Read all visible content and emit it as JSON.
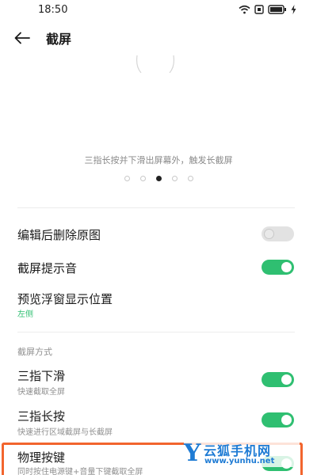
{
  "status_bar": {
    "time": "18:50",
    "icons": [
      "wifi-icon",
      "sim-icon",
      "battery-icon",
      "charging-icon"
    ]
  },
  "header": {
    "back_icon": "arrow-left-icon",
    "title": "截屏"
  },
  "preview": {
    "caption": "三指长按并下滑出屏幕外，触发长截屏",
    "pager": {
      "total": 5,
      "active_index": 2
    }
  },
  "settings": {
    "delete_original": {
      "label": "编辑后删除原图",
      "enabled": false
    },
    "screenshot_sound": {
      "label": "截屏提示音",
      "enabled": true
    },
    "preview_position": {
      "label": "预览浮窗显示位置",
      "value": "左侧"
    },
    "methods_header": "截屏方式",
    "three_finger_swipe": {
      "label": "三指下滑",
      "subtitle": "快速截取全屏",
      "enabled": true
    },
    "three_finger_hold": {
      "label": "三指长按",
      "subtitle": "快速进行区域截屏与长截屏",
      "enabled": true
    },
    "physical_keys": {
      "label": "物理按键",
      "subtitle": "同时按住电源键+音量下键截取全屏",
      "enabled": true
    }
  },
  "watermark": {
    "letter": "Y",
    "name": "云狐手机网",
    "url": "www.yunhu.net"
  },
  "colors": {
    "accent": "#2fbf71",
    "highlight": "#f2652e",
    "watermark": "#1e7bd4"
  }
}
